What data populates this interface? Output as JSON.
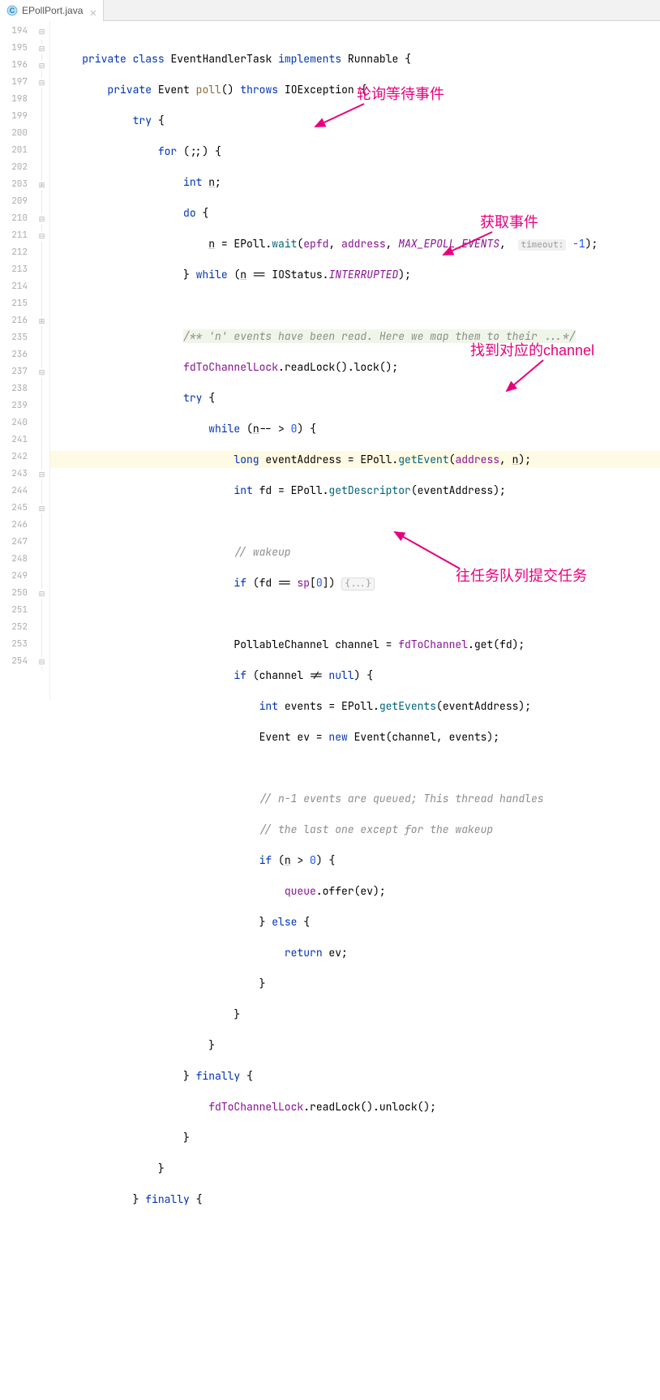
{
  "tab": {
    "filename": "EPollPort.java"
  },
  "gutter_lines": [
    "194",
    "195",
    "196",
    "197",
    "198",
    "199",
    "200",
    "201",
    "202",
    "203",
    "209",
    "210",
    "211",
    "212",
    "213",
    "214",
    "215",
    "216",
    "235",
    "236",
    "237",
    "238",
    "239",
    "240",
    "241",
    "242",
    "243",
    "244",
    "245",
    "246",
    "247",
    "248",
    "249",
    "250",
    "251",
    "252",
    "253",
    "254"
  ],
  "annotations": {
    "a1": "轮询等待事件",
    "a2": "获取事件",
    "a3": "找到对应的channel",
    "a4": "往任务队列提交任务"
  },
  "code": {
    "l194": {
      "kw1": "private",
      "kw2": "class",
      "cls": "EventHandlerTask",
      "kw3": "implements",
      "iface": "Runnable",
      "brace": " {"
    },
    "l195": {
      "kw1": "private",
      "type": "Event",
      "name": "poll",
      "paren": "()",
      "kw2": "throws",
      "exc": "IOException",
      "brace": " {"
    },
    "l196": {
      "kw": "try",
      "brace": " {"
    },
    "l197": {
      "kw": "for",
      "cond": " (;;) {"
    },
    "l198": {
      "kw": "int",
      "var": "n",
      "semi": ";"
    },
    "l199": {
      "kw": "do",
      "brace": " {"
    },
    "l200": {
      "var": "n",
      "eq": " = EPoll.",
      "m": "wait",
      "open": "(",
      "p1": "epfd",
      "c1": ", ",
      "p2": "address",
      "c2": ", ",
      "p3": "MAX_EPOLL_EVENTS",
      "c3": ",  ",
      "hint": "timeout:",
      "sp": " ",
      "num": "-1",
      "close": ");"
    },
    "l201": {
      "close": "} ",
      "kw": "while",
      "open": " (",
      "var": "n",
      "eq": " == IOStatus.",
      "c": "INTERRUPTED",
      "end": ");"
    },
    "l203": {
      "doc": "/** 'n' events have been read. Here we map them to their ...*/"
    },
    "l209": {
      "f": "fdToChannelLock",
      "call": ".readLock().lock();"
    },
    "l210": {
      "kw": "try",
      "brace": " {"
    },
    "l211": {
      "kw": "while",
      "open": " (",
      "var": "n",
      "rest": "-- > ",
      "num": "0",
      "close": ") {"
    },
    "l212": {
      "kw": "long",
      "var": " eventAddress = EPoll.",
      "m": "getEvent",
      "open": "(",
      "p1": "address",
      "c": ", ",
      "p2": "n",
      "close": ");"
    },
    "l213": {
      "kw": "int",
      "var": " fd = EPoll.",
      "m": "getDescriptor",
      "rest": "(eventAddress);"
    },
    "l215": {
      "c": "// wakeup"
    },
    "l216": {
      "kw": "if",
      "open": " (fd == ",
      "f": "sp",
      "idx": "[",
      "num": "0",
      "close": "]) ",
      "fold": "{...}"
    },
    "l236": {
      "type": "PollableChannel channel = ",
      "f": "fdToChannel",
      "call": ".get(fd);"
    },
    "l237": {
      "kw": "if",
      "open": " (channel != ",
      "kw2": "null",
      "close": ") {"
    },
    "l238": {
      "kw": "int",
      "var": " events = EPoll.",
      "m": "getEvents",
      "rest": "(eventAddress);"
    },
    "l239": {
      "type": "Event ev = ",
      "kw": "new",
      "rest": " Event(channel, events);"
    },
    "l241": {
      "c": "// n-1 events are queued; This thread handles"
    },
    "l242": {
      "c": "// the last one except for the wakeup"
    },
    "l243": {
      "kw": "if",
      "open": " (",
      "var": "n",
      "gt": " > ",
      "num": "0",
      "close": ") {"
    },
    "l244": {
      "f": "queue",
      "call": ".offer(ev);"
    },
    "l245": {
      "close": "} ",
      "kw": "else",
      "brace": " {"
    },
    "l246": {
      "kw": "return",
      "rest": " ev;"
    },
    "l247": {
      "brace": "}"
    },
    "l248": {
      "brace": "}"
    },
    "l249": {
      "brace": "}"
    },
    "l250": {
      "close": "} ",
      "kw": "finally",
      "brace": " {"
    },
    "l251": {
      "f": "fdToChannelLock",
      "call": ".readLock().unlock();"
    },
    "l252": {
      "brace": "}"
    },
    "l253": {
      "brace": "}"
    },
    "l254": {
      "close": "} ",
      "kw": "finally",
      "brace": " {"
    }
  }
}
